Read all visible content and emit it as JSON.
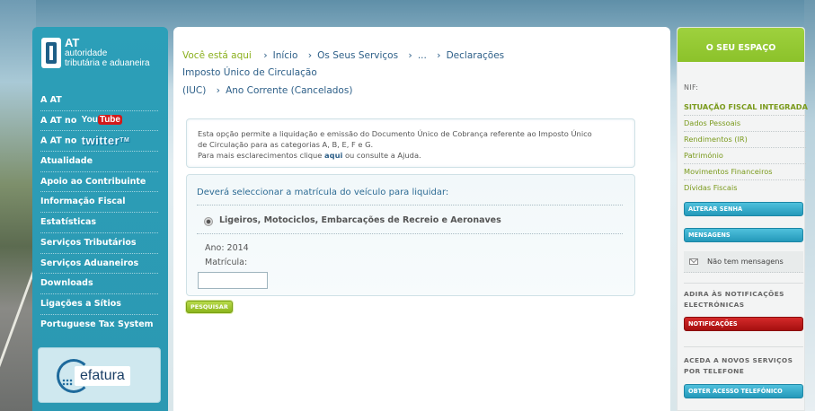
{
  "logo": {
    "at": "AT",
    "line1": "autoridade",
    "line2": "tributária e aduaneira"
  },
  "nav": {
    "items": [
      {
        "label": "A AT"
      },
      {
        "label": "A AT no",
        "badge": "youtube"
      },
      {
        "label": "A AT no",
        "badge": "twitter"
      },
      {
        "label": "Atualidade"
      },
      {
        "label": "Apoio ao Contribuinte"
      },
      {
        "label": "Informação Fiscal"
      },
      {
        "label": "Estatísticas"
      },
      {
        "label": "Serviços Tributários"
      },
      {
        "label": "Serviços Aduaneiros"
      },
      {
        "label": "Downloads"
      },
      {
        "label": "Ligações a Sítios"
      },
      {
        "label": "Portuguese Tax System"
      }
    ],
    "youtube_you": "You",
    "youtube_tube": "Tube",
    "twitter_text": "twitter",
    "twitter_tm": "TM"
  },
  "efatura": {
    "label": "efatura"
  },
  "breadcrumb": {
    "here": "Você está aqui",
    "items": [
      "Início",
      "Os Seus Serviços",
      "...",
      "Declarações"
    ],
    "current_part1": "Imposto Único de Circulação",
    "current_part2": "(IUC)",
    "last": "Ano Corrente (Cancelados)"
  },
  "info": {
    "line1": "Esta opção permite a liquidação e emissão do Documento Único de Cobrança referente ao Imposto Único",
    "line2": "de Circulação para as categorias A, B, E, F e G.",
    "line3_pre": "Para mais esclarecimentos clique ",
    "line3_link": "aqui",
    "line3_post": " ou consulte a Ajuda."
  },
  "form": {
    "title": "Deverá seleccionar a matrícula do veículo para liquidar:",
    "radio_label": "Ligeiros, Motociclos, Embarcações de Recreio e Aeronaves",
    "ano": "Ano: 2014",
    "matricula_label": "Matrícula:",
    "matricula_value": "",
    "search_button": "PESQUISAR"
  },
  "right": {
    "header": "O SEU ESPAÇO",
    "nif_label": "NIF:",
    "links": [
      "SITUAÇÃO FISCAL INTEGRADA",
      "Dados Pessoais",
      "Rendimentos (IR)",
      "Património",
      "Movimentos Financeiros",
      "Dívidas Fiscais"
    ],
    "alterar_senha": "ALTERAR SENHA",
    "mensagens": "MENSAGENS",
    "no_messages": "Não tem mensagens",
    "notif_heading": "ADIRA ÀS NOTIFICAÇÕES ELECTRÓNICAS",
    "notif_button": "NOTIFICAÇÕES",
    "phone_heading": "ACEDA A NOVOS SERVIÇOS POR TELEFONE",
    "phone_button": "OBTER ACESSO TELEFÓNICO"
  },
  "colors": {
    "nav_bg": "#2c9fb8",
    "accent_green": "#8cc22a",
    "link_blue": "#2d5f88",
    "button_red": "#a60f0f"
  }
}
